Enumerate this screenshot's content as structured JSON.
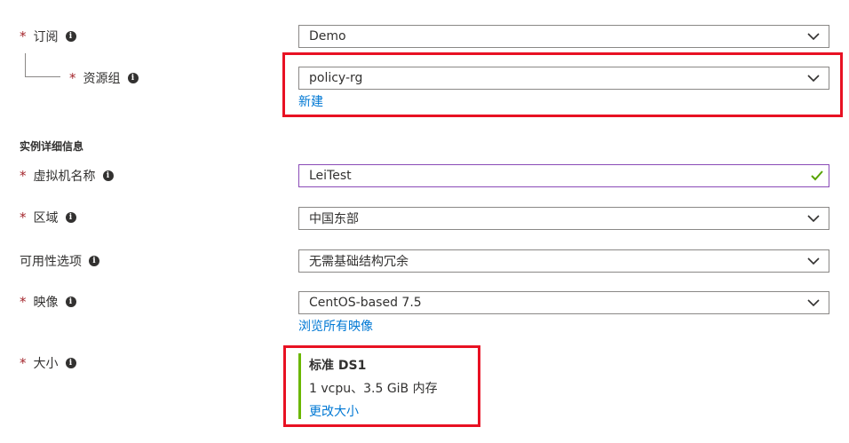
{
  "form": {
    "subscription": {
      "label": "订阅",
      "value": "Demo"
    },
    "resource_group": {
      "label": "资源组",
      "value": "policy-rg",
      "create_link": "新建"
    },
    "section_title": "实例详细信息",
    "vm_name": {
      "label": "虚拟机名称",
      "value": "LeiTest"
    },
    "region": {
      "label": "区域",
      "value": "中国东部"
    },
    "availability": {
      "label": "可用性选项",
      "value": "无需基础结构冗余"
    },
    "image": {
      "label": "映像",
      "value": "CentOS-based 7.5",
      "browse_link": "浏览所有映像"
    },
    "size": {
      "label": "大小",
      "name": "标准 DS1",
      "spec": "1 vcpu、3.5 GiB 内存",
      "change_link": "更改大小"
    }
  },
  "icons": {
    "info": "info-icon",
    "dropdown": "chevron-down-icon",
    "valid": "checkmark-icon"
  },
  "colors": {
    "required": "#a4262c",
    "link": "#0078d4",
    "highlight": "#e81123",
    "valid": "#57a300",
    "size_accent": "#6bb700"
  }
}
